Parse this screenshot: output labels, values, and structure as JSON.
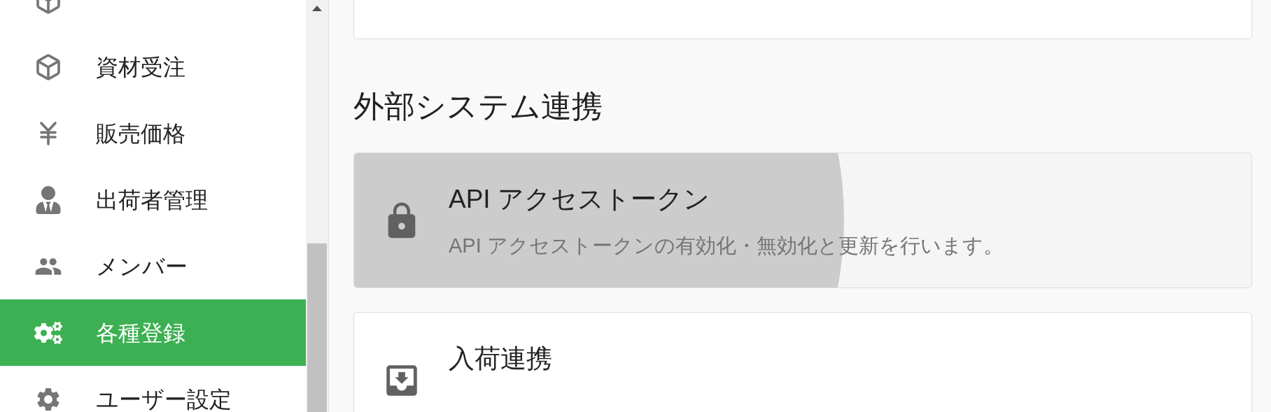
{
  "sidebar": {
    "items": [
      {
        "label": "資材受注",
        "selected": false
      },
      {
        "label": "販売価格",
        "selected": false
      },
      {
        "label": "出荷者管理",
        "selected": false
      },
      {
        "label": "メンバー",
        "selected": false
      },
      {
        "label": "各種登録",
        "selected": true
      },
      {
        "label": "ユーザー設定",
        "selected": false
      }
    ]
  },
  "main": {
    "section_title": "外部システム連携",
    "cards": [
      {
        "title": "API アクセストークン",
        "description": "API アクセストークンの有効化・無効化と更新を行います。",
        "pressed": true
      },
      {
        "title": "入荷連携",
        "pressed": false
      }
    ]
  }
}
